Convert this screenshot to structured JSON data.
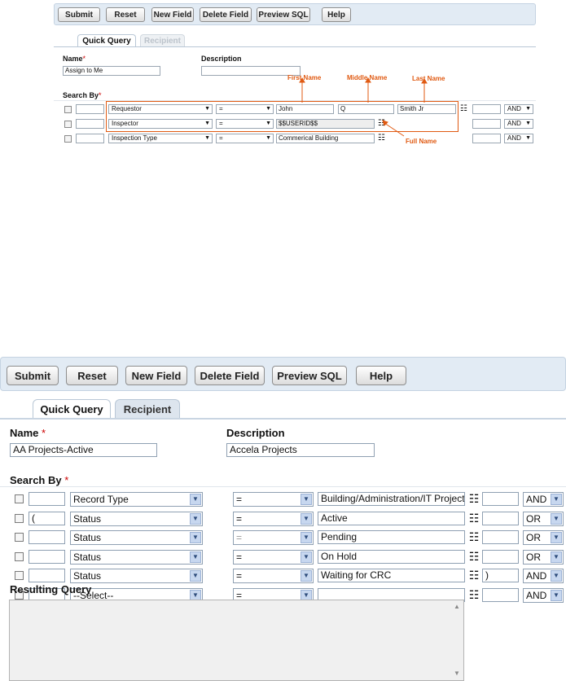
{
  "toolbar": {
    "submit": "Submit",
    "reset": "Reset",
    "new_field": "New Field",
    "delete_field": "Delete Field",
    "preview_sql": "Preview SQL",
    "help": "Help"
  },
  "tabs": {
    "quick_query": "Quick Query",
    "recipient": "Recipient"
  },
  "labels": {
    "name": "Name",
    "description": "Description",
    "search_by": "Search By",
    "resulting_query": "Resulting Query",
    "required_mark": "*"
  },
  "example_small": {
    "name_value": "Assign to Me",
    "description_value": "",
    "rows": [
      {
        "paren_open": "",
        "field": "Requestor",
        "operator": "=",
        "value": "John",
        "value2": "Q",
        "value3": "Smith Jr",
        "paren_close": "",
        "conjunction": "AND"
      },
      {
        "paren_open": "",
        "field": "Inspector",
        "operator": "=",
        "value": "$$USERID$$",
        "paren_close": "",
        "conjunction": "AND"
      },
      {
        "paren_open": "",
        "field": "Inspection Type",
        "operator": "=",
        "value": "Commerical Building",
        "paren_close": "",
        "conjunction": "AND"
      }
    ],
    "annotations": {
      "first_name": "First Name",
      "middle_name": "Middle Name",
      "last_name": "Last Name",
      "full_name": "Full Name"
    }
  },
  "example_large": {
    "name_value": "AA Projects-Active",
    "description_value": "Accela Projects",
    "rows": [
      {
        "paren_open": "",
        "field": "Record Type",
        "operator": "=",
        "value": "Building/Administration/IT Project",
        "paren_close": "",
        "conjunction": "AND"
      },
      {
        "paren_open": "(",
        "field": "Status",
        "operator": "=",
        "value": "Active",
        "paren_close": "",
        "conjunction": "OR"
      },
      {
        "paren_open": "",
        "field": "Status",
        "operator": "=",
        "value": "Pending",
        "paren_close": "",
        "conjunction": "OR",
        "operator_disabled": true
      },
      {
        "paren_open": "",
        "field": "Status",
        "operator": "=",
        "value": "On Hold",
        "paren_close": "",
        "conjunction": "OR"
      },
      {
        "paren_open": "",
        "field": "Status",
        "operator": "=",
        "value": "Waiting for CRC",
        "paren_close": ")",
        "conjunction": "AND"
      },
      {
        "paren_open": "",
        "field": "--Select--",
        "operator": "=",
        "value": "",
        "paren_close": "",
        "conjunction": "AND"
      }
    ],
    "resulting_query": ""
  },
  "icons": {
    "value_picker": "value-picker-icon",
    "dropdown": "chevron-down-icon"
  },
  "colors": {
    "toolbar_bg": "#e2ebf4",
    "required": "#cc0000",
    "annotation": "#e05a12",
    "select_arrow": "#c7d7ef"
  }
}
